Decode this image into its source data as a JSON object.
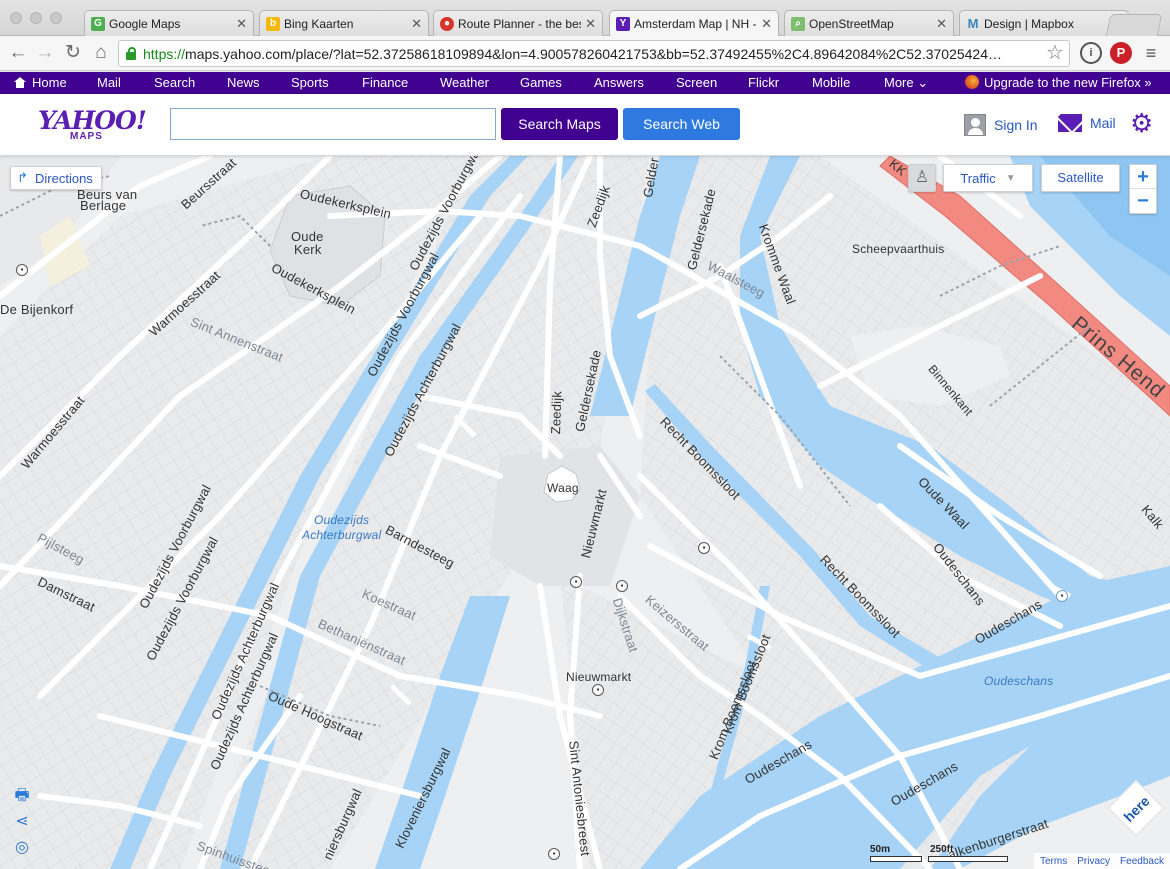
{
  "browser": {
    "tabs": [
      {
        "label": "Google Maps",
        "favicon": "google-maps",
        "color": "#4caf50"
      },
      {
        "label": "Bing Kaarten",
        "favicon": "bing",
        "color": "#f5b800"
      },
      {
        "label": "Route Planner - the bes",
        "favicon": "route-planner",
        "color": "#d9342b"
      },
      {
        "label": "Amsterdam Map | NH -",
        "favicon": "yahoo",
        "color": "#5a1eb4"
      },
      {
        "label": "OpenStreetMap",
        "favicon": "openstreetmap",
        "color": "#7ebc6f"
      },
      {
        "label": "Design | Mapbox",
        "favicon": "mapbox",
        "color": "#3887be"
      }
    ],
    "url_scheme": "https://",
    "url_rest": "maps.yahoo.com/place/?lat=52.37258618109894&lon=4.900578260421753&bb=52.37492455%2C4.89642084%2C52.37025424…"
  },
  "yahoo_nav": {
    "items": [
      "Home",
      "Mail",
      "Search",
      "News",
      "Sports",
      "Finance",
      "Weather",
      "Games",
      "Answers",
      "Screen",
      "Flickr",
      "Mobile",
      "More"
    ],
    "upgrade": "Upgrade to the new Firefox »"
  },
  "header": {
    "logo": "YAHOO!",
    "logo_sub": "MAPS",
    "search_value": "",
    "search_maps": "Search Maps",
    "search_web": "Search Web",
    "sign_in": "Sign In",
    "mail": "Mail"
  },
  "map": {
    "directions": "Directions",
    "traffic": "Traffic",
    "satellite": "Satellite",
    "zoom_in": "+",
    "zoom_out": "−",
    "labels": {
      "beurs": "Beurs van",
      "berlage": "Berlage",
      "beursstraat": "Beursstraat",
      "oudekerksplein_top": "Oudekerksplein",
      "oude": "Oude",
      "kerk": "Kerk",
      "oudekerksplein_bottom": "Oudekerksplein",
      "de_bijenkorf": "De Bijenkorf",
      "warmoesstraat_1": "Warmoesstraat",
      "warmoesstraat_2": "Warmoesstraat",
      "sint_annenstraat": "Sint Annenstraat",
      "oz_voorburgwal_1": "Oudezijds Voorburgwal",
      "oz_voorburgwal_2": "Oudezijds Voorburgwal",
      "oz_voorburgwal_3": "Oudezijds Voorburgwal",
      "oz_voorburgwal_4": "Oudezijds Voorburgwal",
      "oz_achterburgwal_1": "Oudezijds Achterburgwal",
      "oz_achterburgwal_2": "Oudezijds Achterburgwal",
      "oz_achterburgwal_3": "Oudezijds Achterburgwal",
      "oz_water_1": "Oudezijds",
      "oz_water_2": "Achterburgwal",
      "pijlsteeg": "Pijlsteeg",
      "damstraat": "Damstraat",
      "barndesteeg": "Barndesteeg",
      "koestraat": "Koestraat",
      "bethanienstraat": "Bethaniënstraat",
      "oude_hoogstraat": "Oude Hoogstraat",
      "kloveniersburgwal_1": "Kloveniersburgwal",
      "kloveniersburgwal_2": "niersburgwal",
      "spinhuissteeg": "Spinhuissteeg",
      "zeedijk_1": "Zeedijk",
      "zeedijk_2": "Zeedijk",
      "gelder": "Gelder",
      "geldersekade_1": "Geldersekade",
      "geldersekade_2": "Geldersekade",
      "waalsteeg": "Waalsteeg",
      "kromme_waal": "Kromme Waal",
      "scheepvaarthuis": "Scheepvaarthuis",
      "prins_hendrik": "Prins Hend",
      "binnenkant": "Binnenkant",
      "recht_boomssloot_1": "Recht Boomssloot",
      "recht_boomssloot_2": "Recht Boomssloot",
      "oude_waal": "Oude Waal",
      "oudeschans_1": "Oudeschans",
      "oudeschans_2": "Oudeschans",
      "oudeschans_3": "Oudeschans",
      "oudeschans_4": "Oudeschans",
      "oudeschans_water": "Oudeschans",
      "waag": "Waag",
      "nieuwmarkt_1": "Nieuwmarkt",
      "nieuwmarkt_2": "Nieuwmarkt",
      "dijkstraat": "Dijkstraat",
      "keizersstraat": "Keizersstraat",
      "krom_boomssloot_1": "Krom Boomssloot",
      "krom_boomssloot_2": "Krom Boomssloot",
      "sint_antoniesbreestraat": "Sint Antoniesbreest",
      "valkenburgerstraat": "alkenburgerstraat",
      "kalk": "Kalk",
      "kk": "KK"
    },
    "scale_m": "50m",
    "scale_ft": "250ft",
    "footer": {
      "terms": "Terms",
      "privacy": "Privacy",
      "feedback": "Feedback"
    },
    "here_logo": "here",
    "colors": {
      "water": "#a6d3f6",
      "water_dark": "#7fbdf0",
      "land": "#eeeff1",
      "road": "#ffffff",
      "major_road": "#f28a82",
      "yahoo_purple": "#400090"
    }
  }
}
